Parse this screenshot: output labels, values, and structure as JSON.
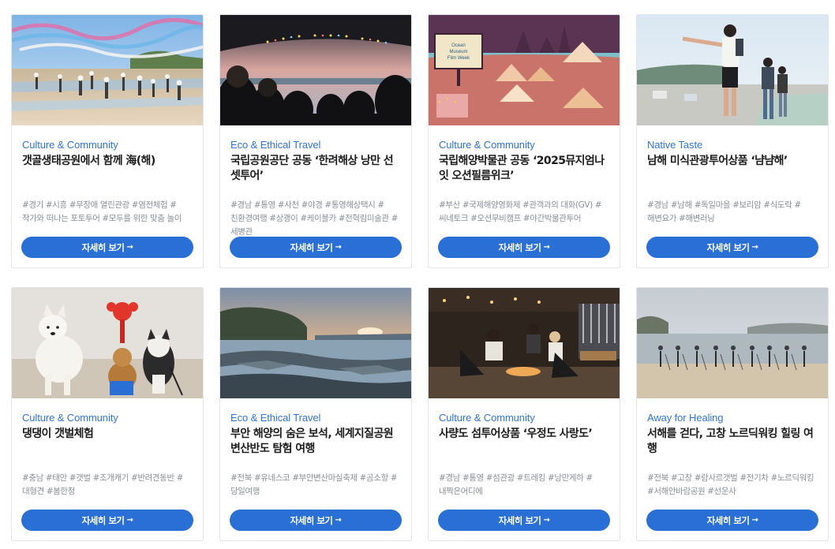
{
  "cards": [
    {
      "category": "Culture & Community",
      "title": "갯골생태공원에서 함께 海(해)",
      "tags": "#경기 #시흥 #무장애 열린관광 #염전체험 #작가와 떠나는 포토투어 #모두를 위한 맞춤 놀이",
      "button": "자세히 보기",
      "image": "salt-flat-crowd-flags-photo"
    },
    {
      "category": "Eco & Ethical Travel",
      "title": "국립공원공단 공동 ‘한려해상 낭만 선셋투어’",
      "tags": "#경남 #통영 #사천 #야경 #통영해상택시 #친환경여행 #상괭이 #케이블카 #전혁림미술관 #세병관",
      "button": "자세히 보기",
      "image": "night-boat-passengers-photo"
    },
    {
      "category": "Culture & Community",
      "title": "국립해양박물관 공동 ‘2025뮤지엄나잇 오션필름위크’",
      "tags": "#부산 #국제해양영화제 #관객과의 대화(GV) #씨네토크 #오션무비캠프 #야간박물관투어",
      "button": "자세히 보기",
      "image": "camping-film-illustration",
      "screen_text": [
        "Ocean",
        "Museum",
        "Film Week"
      ]
    },
    {
      "category": "Native Taste",
      "title": "남해 미식관광투어상품 ‘냠냠해’",
      "tags": "#경남 #남해 #독일마을 #보리암 #식도락 #해변요가 #해변러닝",
      "button": "자세히 보기",
      "image": "seaside-walkers-photo"
    },
    {
      "category": "Culture & Community",
      "title": "댕댕이 갯벌체험",
      "tags": "#충남 #태안 #갯벌 #조개캐기 #반려견동반 #대형견 #봄한정",
      "button": "자세히 보기",
      "image": "dogs-on-mudflat-photo"
    },
    {
      "category": "Eco & Ethical Travel",
      "title": "부안 해양의 숨은 보석, 세계지질공원 변산반도 탐험 여행",
      "tags": "#전북 #유네스코 #부안변산마실축제 #곰소항 #당일여행",
      "button": "자세히 보기",
      "image": "rocky-coast-sunset-photo"
    },
    {
      "category": "Culture & Community",
      "title": "사량도 섬투어상품 ‘우정도 사랑도’",
      "tags": "#경남 #통영 #섬관광 #트레킹 #낭만게하 #내짝은어디에",
      "button": "자세히 보기",
      "image": "night-camping-friends-photo"
    },
    {
      "category": "Away for Healing",
      "title": "서해를 걷다, 고창 노르딕워킹 힐링 여행",
      "tags": "#전북 #고창 #람사르갯벌 #전기차 #노르딕워킹 #서해안바람공원 #선운사",
      "button": "자세히 보기",
      "image": "beach-nordic-walking-photo"
    }
  ],
  "arrow_icon": "arrow-right-icon",
  "colors": {
    "accent": "#2a6fd6",
    "category": "#2e74d6",
    "tag": "#8a8f96"
  }
}
